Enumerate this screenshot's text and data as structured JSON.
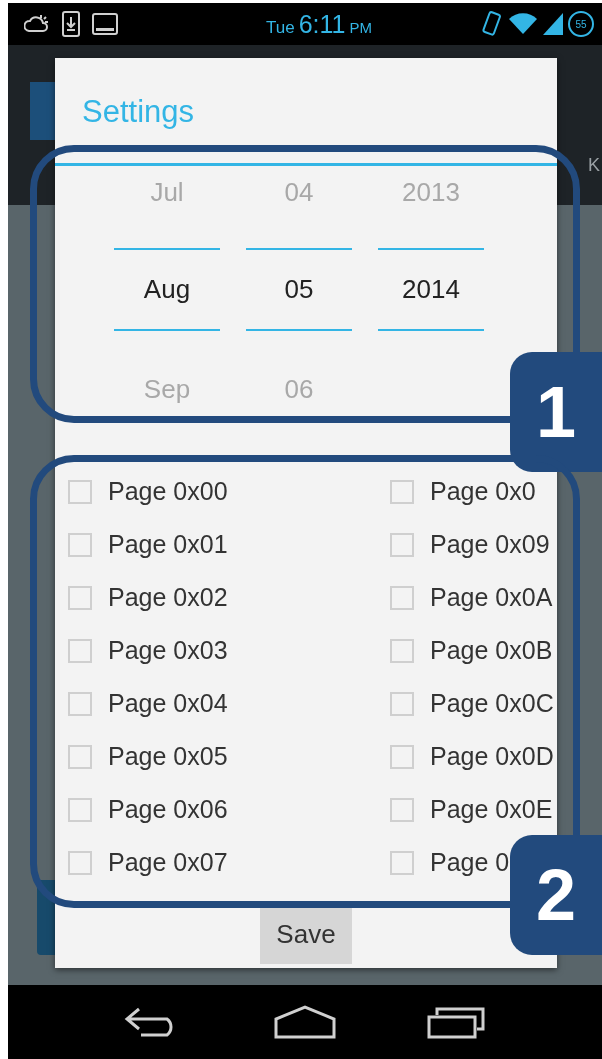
{
  "status_bar": {
    "day": "Tue",
    "time": "6:11",
    "meridiem": "PM",
    "battery": "55"
  },
  "app_bar": {
    "fragment": "K"
  },
  "dialog": {
    "title": "Settings",
    "date_picker": {
      "columns": [
        {
          "previous": "Jul",
          "current": "Aug",
          "next": "Sep"
        },
        {
          "previous": "04",
          "current": "05",
          "next": "06"
        },
        {
          "previous": "2013",
          "current": "2014"
        }
      ]
    },
    "pages": {
      "columns": [
        [
          {
            "label": "Page 0x00",
            "checked": false
          },
          {
            "label": "Page 0x01",
            "checked": false
          },
          {
            "label": "Page 0x02",
            "checked": false
          },
          {
            "label": "Page 0x03",
            "checked": false
          },
          {
            "label": "Page 0x04",
            "checked": false
          },
          {
            "label": "Page 0x05",
            "checked": false
          },
          {
            "label": "Page 0x06",
            "checked": false
          },
          {
            "label": "Page 0x07",
            "checked": false
          }
        ],
        [
          {
            "label": "Page 0x0",
            "checked": false
          },
          {
            "label": "Page 0x09",
            "checked": false
          },
          {
            "label": "Page 0x0A",
            "checked": false
          },
          {
            "label": "Page 0x0B",
            "checked": false
          },
          {
            "label": "Page 0x0C",
            "checked": false
          },
          {
            "label": "Page 0x0D",
            "checked": false
          },
          {
            "label": "Page 0x0E",
            "checked": false
          },
          {
            "label": "Page 0",
            "checked": false
          }
        ]
      ]
    },
    "save": "Save"
  },
  "callouts": [
    {
      "label": "1"
    },
    {
      "label": "2"
    }
  ]
}
